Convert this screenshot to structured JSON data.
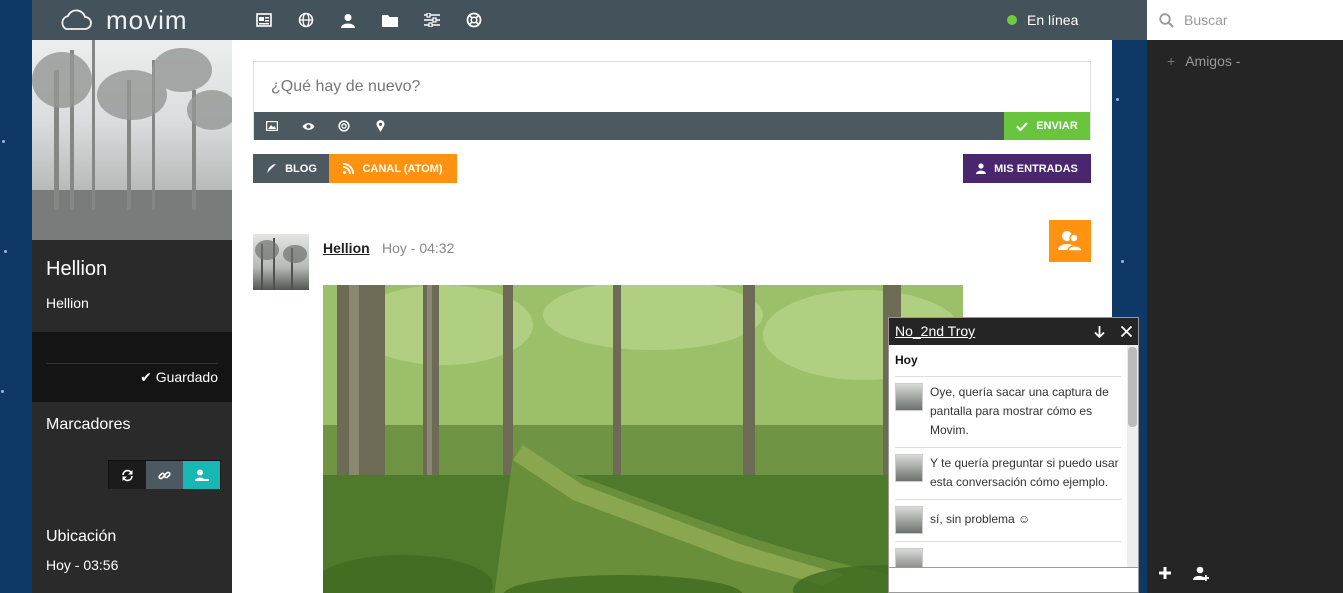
{
  "app": {
    "brand": "movim",
    "status": "En línea",
    "colors": {
      "topbar": "#44525b",
      "accent_green": "#6ac53e",
      "accent_orange": "#ff9211",
      "accent_purple": "#4a2670",
      "accent_teal": "#19b7b3"
    }
  },
  "nav": {
    "icons": [
      "news-icon",
      "globe-icon",
      "contacts-icon",
      "folder-icon",
      "settings-icon",
      "help-icon"
    ]
  },
  "search": {
    "placeholder": "Buscar"
  },
  "roster": {
    "group_label": "Amigos -",
    "footer_icons": [
      "add-icon",
      "add-contact-icon"
    ]
  },
  "sidebar": {
    "name": "Hellion",
    "subtitle": "Hellion",
    "saved": "Guardado",
    "bookmarks_title": "Marcadores",
    "location_title": "Ubicación",
    "location_time": "Hoy - 03:56"
  },
  "composer": {
    "placeholder": "¿Qué hay de nuevo?",
    "send_label": "ENVIAR"
  },
  "tabs": {
    "blog": "BLOG",
    "feed": "CANAL (ATOM)",
    "my_posts": "MIS ENTRADAS"
  },
  "post": {
    "author": "Hellion",
    "time": "Hoy - 04:32"
  },
  "chat": {
    "title": "No_2nd Troy",
    "day": "Hoy",
    "messages": [
      {
        "text": "Oye, quería sacar una captura de pantalla para mostrar cómo es Movim."
      },
      {
        "text": "Y te quería preguntar si puedo usar esta conversación cómo ejemplo."
      },
      {
        "text": "sí, sin problema ☺"
      }
    ]
  }
}
